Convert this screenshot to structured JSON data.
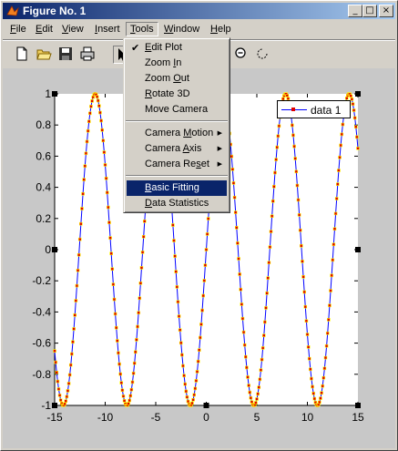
{
  "window": {
    "title": "Figure No. 1"
  },
  "title_buttons": {
    "minimize": "_",
    "maximize": "□",
    "close": "×"
  },
  "menu": {
    "items": [
      {
        "label": "File",
        "acc_index": 0
      },
      {
        "label": "Edit",
        "acc_index": 0
      },
      {
        "label": "View",
        "acc_index": 0
      },
      {
        "label": "Insert",
        "acc_index": 0
      },
      {
        "label": "Tools",
        "acc_index": 0
      },
      {
        "label": "Window",
        "acc_index": 0
      },
      {
        "label": "Help",
        "acc_index": 0
      }
    ],
    "open": "Tools"
  },
  "toolbar": {
    "icons": [
      "new-file-icon",
      "open-folder-icon",
      "save-icon",
      "print-icon",
      "pointer-arrow-icon",
      "zoom-out-icon",
      "rotate-icon"
    ]
  },
  "tools_menu": {
    "items": [
      {
        "label": "Edit Plot",
        "checked": true,
        "submenu": false,
        "acc": "E"
      },
      {
        "label": "Zoom In",
        "checked": false,
        "submenu": false,
        "acc": "I"
      },
      {
        "label": "Zoom Out",
        "checked": false,
        "submenu": false,
        "acc": "O"
      },
      {
        "label": "Rotate 3D",
        "checked": false,
        "submenu": false,
        "acc": "R"
      },
      {
        "label": "Move Camera",
        "checked": false,
        "submenu": false,
        "acc": ""
      },
      {
        "label": "Camera Motion",
        "checked": false,
        "submenu": true,
        "acc": "M"
      },
      {
        "label": "Camera Axis",
        "checked": false,
        "submenu": true,
        "acc": "A"
      },
      {
        "label": "Camera Reset",
        "checked": false,
        "submenu": true,
        "acc": "s"
      },
      {
        "label": "Basic Fitting",
        "checked": false,
        "submenu": false,
        "acc": "B",
        "highlighted": true
      },
      {
        "label": "Data Statistics",
        "checked": false,
        "submenu": false,
        "acc": "D"
      }
    ]
  },
  "legend": {
    "label": "data 1"
  },
  "colors": {
    "line": "#0000ff",
    "marker": "#e00000",
    "marker_edge": "#ffff00",
    "title_bar": "#0a246a",
    "highlight": "#0a246a"
  },
  "chart_data": {
    "type": "line",
    "function": "sin(x)",
    "xlim": [
      -15,
      15
    ],
    "ylim": [
      -1,
      1
    ],
    "xticks": [
      -15,
      -10,
      -5,
      0,
      5,
      10,
      15
    ],
    "yticks": [
      1,
      0.8,
      0.6,
      0.4,
      0.2,
      0,
      -0.2,
      -0.4,
      -0.6,
      -0.8,
      -1
    ],
    "xtick_labels": [
      "-15",
      "-10",
      "-5",
      "0",
      "5",
      "10",
      "15"
    ],
    "ytick_labels": [
      "1",
      "0.8",
      "0.6",
      "0.4",
      "0.2",
      "0",
      "-0.2",
      "-0.4",
      "-0.6",
      "-0.8",
      "-1"
    ],
    "series": [
      {
        "name": "data 1",
        "x_start": -15,
        "x_end": 15,
        "x_step": 0.1,
        "marker": "square"
      }
    ],
    "legend_position": "top-right",
    "grid": false
  }
}
